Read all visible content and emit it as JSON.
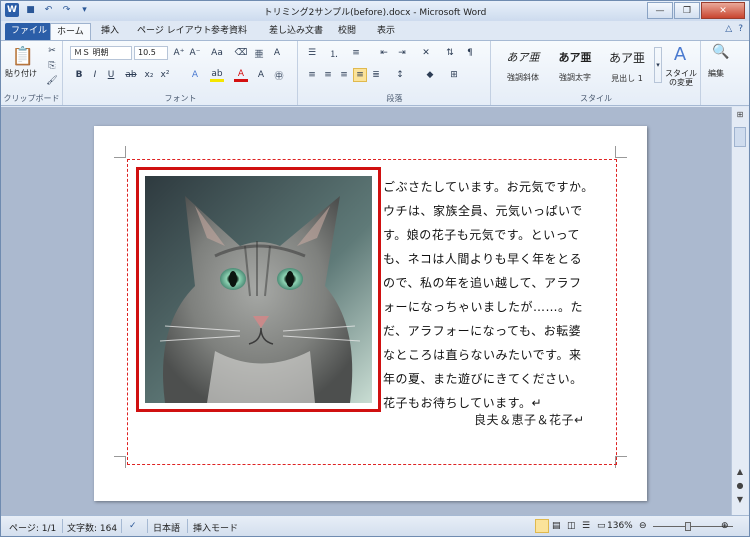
{
  "window": {
    "title": "トリミング2サンプル(before).docx - Microsoft Word"
  },
  "ribbon_tabs": [
    "ファイル",
    "ホーム",
    "挿入",
    "ページ レイアウト",
    "参考資料",
    "差し込み文書",
    "校閲",
    "表示"
  ],
  "clipboard": {
    "paste_label": "貼り付け",
    "group_label": "クリップボード"
  },
  "font": {
    "name": "ＭＳ 明朝",
    "size": "10.5",
    "group_label": "フォント"
  },
  "paragraph": {
    "group_label": "段落"
  },
  "styles": {
    "items": [
      {
        "sample": "あア亜",
        "name": "強調斜体"
      },
      {
        "sample": "あア亜",
        "name": "強調太字"
      },
      {
        "sample": "あア亜",
        "name": "見出し 1"
      }
    ],
    "change_label": "スタイルの変更",
    "group_label": "スタイル"
  },
  "editing": {
    "label": "編集"
  },
  "document": {
    "body_lines": [
      "ごぶさたしています。お元気ですか。",
      "ウチは、家族全員、元気いっぱいで",
      "す。娘の花子も元気です。といって",
      "も、ネコは人間よりも早く年をとる",
      "ので、私の年を追い越して、アラフ",
      "ォーになっちゃいましたが……。た",
      "だ、アラフォーになっても、お転婆",
      "なところは直らないみたいです。来",
      "年の夏、また遊びにきてください。",
      "花子もお待ちしています。↵"
    ],
    "signature": "良夫＆恵子＆花子↵"
  },
  "status": {
    "page": "ページ: 1/1",
    "word_count": "文字数: 164",
    "language": "日本語",
    "mode": "挿入モード",
    "zoom": "136%"
  }
}
